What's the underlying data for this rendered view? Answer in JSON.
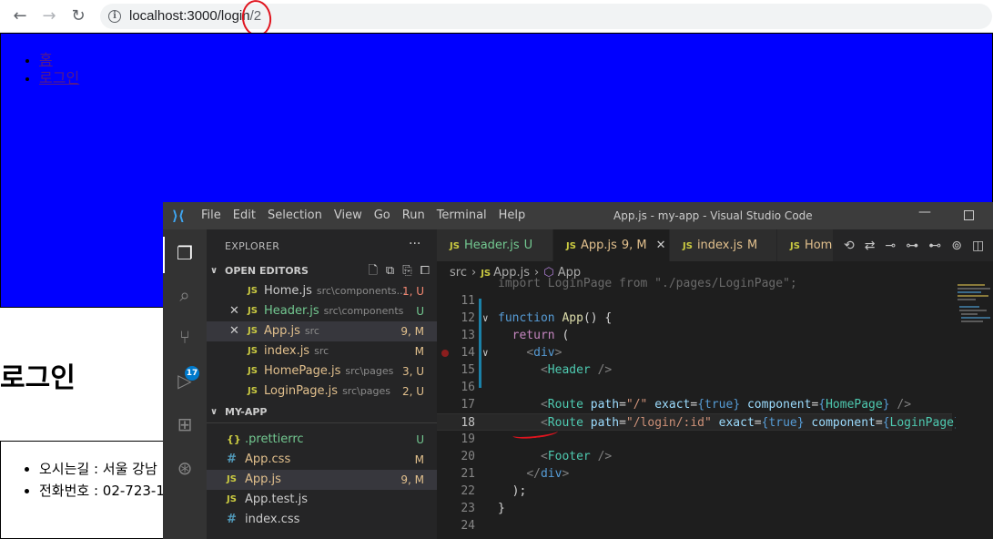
{
  "browser": {
    "url_host": "localhost:3000/login",
    "url_path": "/2"
  },
  "page": {
    "nav": [
      "홈",
      "로그인"
    ],
    "heading": "로그인",
    "footer": [
      "오시는길 : 서울 강남",
      "전화번호 : 02-723-1"
    ]
  },
  "vscode": {
    "menu": [
      "File",
      "Edit",
      "Selection",
      "View",
      "Go",
      "Run",
      "Terminal",
      "Help"
    ],
    "window_title": "App.js - my-app - Visual Studio Code",
    "scm_badge": "17",
    "explorer_title": "EXPLORER",
    "more": "···",
    "open_editors_label": "OPEN EDITORS",
    "open_editors": [
      {
        "name": "Home.js",
        "dir": "src\\components...",
        "status": "1, U"
      },
      {
        "name": "Header.js",
        "dir": "src\\components",
        "status": "U"
      },
      {
        "name": "App.js",
        "dir": "src",
        "status": "9, M"
      },
      {
        "name": "index.js",
        "dir": "src",
        "status": "M"
      },
      {
        "name": "HomePage.js",
        "dir": "src\\pages",
        "status": "3, U"
      },
      {
        "name": "LoginPage.js",
        "dir": "src\\pages",
        "status": "2, U"
      }
    ],
    "project_label": "MY-APP",
    "project_files": [
      {
        "name": ".prettierrc",
        "status": "U"
      },
      {
        "name": "App.css",
        "status": "M"
      },
      {
        "name": "App.js",
        "status": "9, M"
      },
      {
        "name": "App.test.js",
        "status": ""
      },
      {
        "name": "index.css",
        "status": ""
      }
    ],
    "tabs": [
      {
        "name": "Header.js",
        "status": "U"
      },
      {
        "name": "App.js",
        "status": "9, M"
      },
      {
        "name": "index.js",
        "status": "M"
      },
      {
        "name": "Hom",
        "status": ""
      }
    ],
    "breadcrumb": [
      "src",
      "App.js",
      "App"
    ],
    "code_lines": [
      {
        "n": "11",
        "t": ""
      },
      {
        "n": "12",
        "t": "function App() {"
      },
      {
        "n": "13",
        "t": "  return ("
      },
      {
        "n": "14",
        "t": "    <div>"
      },
      {
        "n": "15",
        "t": "      <Header />"
      },
      {
        "n": "16",
        "t": ""
      },
      {
        "n": "17",
        "t": "      <Route path=\"/\" exact={true} component={HomePage} />"
      },
      {
        "n": "18",
        "t": "      <Route path=\"/login/:id\" exact={true} component={LoginPage}"
      },
      {
        "n": "19",
        "t": ""
      },
      {
        "n": "20",
        "t": "      <Footer />"
      },
      {
        "n": "21",
        "t": "    </div>"
      },
      {
        "n": "22",
        "t": "  );"
      },
      {
        "n": "23",
        "t": "}"
      },
      {
        "n": "24",
        "t": ""
      }
    ]
  }
}
